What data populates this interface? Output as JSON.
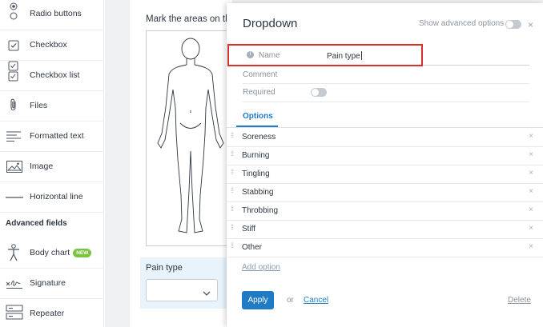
{
  "sidebar": {
    "items": [
      {
        "label": "Radio buttons",
        "icon": "radio-icon"
      },
      {
        "label": "Checkbox",
        "icon": "checkbox-icon"
      },
      {
        "label": "Checkbox list",
        "icon": "checkbox-list-icon"
      },
      {
        "label": "Files",
        "icon": "paperclip-icon"
      },
      {
        "label": "Formatted text",
        "icon": "text-lines-icon"
      },
      {
        "label": "Image",
        "icon": "image-icon"
      },
      {
        "label": "Horizontal line",
        "icon": "horizontal-line-icon"
      }
    ],
    "advanced_heading": "Advanced fields",
    "advanced_items": [
      {
        "label": "Body chart",
        "icon": "body-icon",
        "badge": "NEW"
      },
      {
        "label": "Signature",
        "icon": "signature-icon"
      },
      {
        "label": "Repeater",
        "icon": "repeater-icon"
      }
    ]
  },
  "form": {
    "question_text": "Mark the areas on the",
    "pain_type_label": "Pain type",
    "pain_type_value": ""
  },
  "panel": {
    "title": "Dropdown",
    "advanced_toggle_label": "Show advanced options",
    "advanced_toggle_on": false,
    "close_icon": "×",
    "name_label": "Name",
    "name_value": "Pain type",
    "comment_label": "Comment",
    "required_label": "Required",
    "required_on": false,
    "options_tab": "Options",
    "options": [
      "Soreness",
      "Burning",
      "Tingling",
      "Stabbing",
      "Throbbing",
      "Stiff",
      "Other"
    ],
    "remove_icon": "×",
    "add_option": "Add option",
    "apply": "Apply",
    "or": "or",
    "cancel": "Cancel",
    "delete": "Delete"
  },
  "colors": {
    "accent": "#1f7bc4",
    "highlight": "#d9302b",
    "badge": "#7cc342"
  }
}
